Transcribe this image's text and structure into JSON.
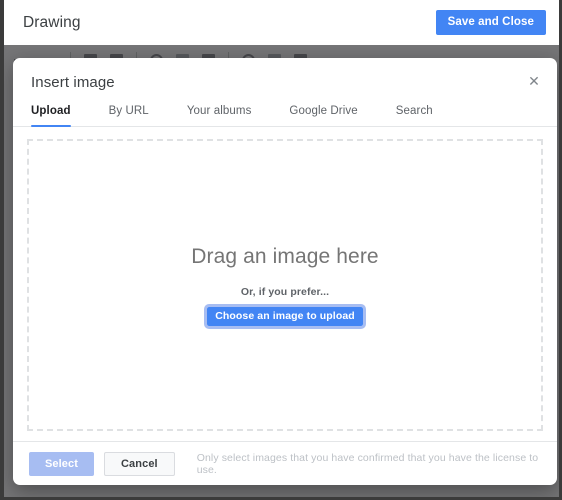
{
  "app": {
    "title": "Drawing",
    "save_close_label": "Save and Close"
  },
  "dialog": {
    "title": "Insert image",
    "close_icon": "close-icon",
    "tabs": [
      {
        "label": "Upload",
        "active": true
      },
      {
        "label": "By URL",
        "active": false
      },
      {
        "label": "Your albums",
        "active": false
      },
      {
        "label": "Google Drive",
        "active": false
      },
      {
        "label": "Search",
        "active": false
      }
    ],
    "dropzone": {
      "heading": "Drag an image here",
      "subtext": "Or, if you prefer...",
      "button_label": "Choose an image to upload"
    },
    "footer": {
      "select_label": "Select",
      "cancel_label": "Cancel",
      "note": "Only select images that you have confirmed that you have the license to use."
    }
  },
  "colors": {
    "accent_blue": "#4285f4",
    "accent_blue_disabled": "#a7bdf2",
    "scrim": "#6b6b6b",
    "dashed_border": "#dfe1e3"
  }
}
